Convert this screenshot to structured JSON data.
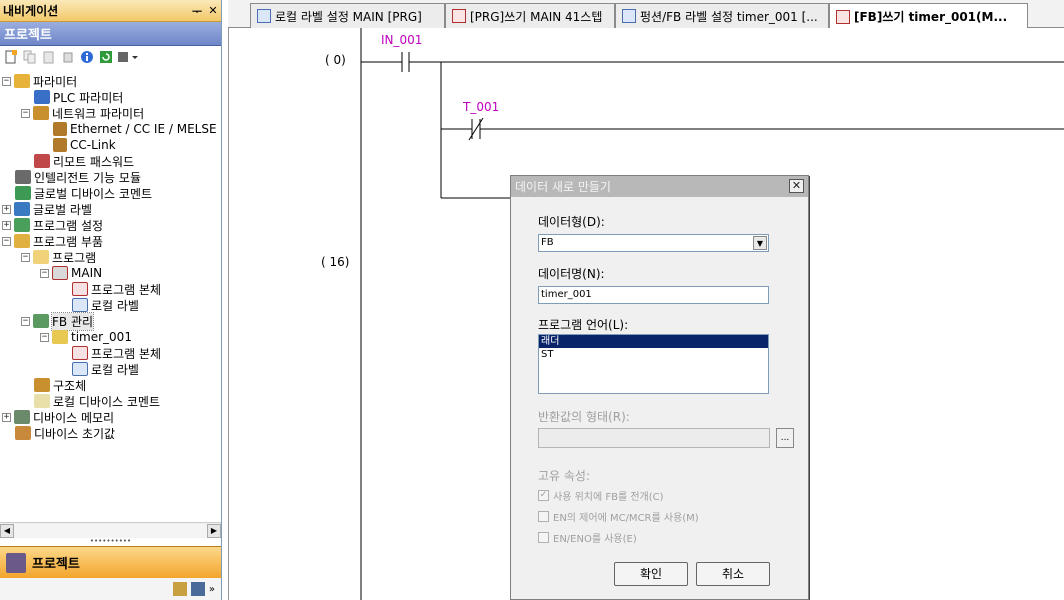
{
  "nav": {
    "title": "내비게이션",
    "pin": "ᅮ",
    "close": "✕",
    "project_header": "프로젝트",
    "tree": [
      {
        "label": "파라미터",
        "expander": "−"
      },
      {
        "label": "PLC 파라미터"
      },
      {
        "label": "네트워크 파라미터",
        "expander": "−"
      },
      {
        "label": "Ethernet / CC IE / MELSE"
      },
      {
        "label": "CC-Link"
      },
      {
        "label": "리모트 패스워드"
      },
      {
        "label": "인텔리전트 기능 모듈"
      },
      {
        "label": "글로벌 디바이스 코멘트"
      },
      {
        "label": "글로벌 라벨",
        "expander": "+"
      },
      {
        "label": "프로그램 설정",
        "expander": "+"
      },
      {
        "label": "프로그램 부품",
        "expander": "−"
      },
      {
        "label": "프로그램",
        "expander": "−"
      },
      {
        "label": "MAIN",
        "expander": "−"
      },
      {
        "label": "프로그램 본체"
      },
      {
        "label": "로컬 라벨"
      },
      {
        "label": "FB 관리",
        "expander": "−"
      },
      {
        "label": "timer_001",
        "expander": "−"
      },
      {
        "label": "프로그램 본체"
      },
      {
        "label": "로컬 라벨"
      },
      {
        "label": "구조체"
      },
      {
        "label": "로컬 디바이스 코멘트"
      },
      {
        "label": "디바이스 메모리",
        "expander": "+"
      },
      {
        "label": "디바이스 초기값"
      }
    ],
    "bottom_tab": "프로젝트"
  },
  "tabs": [
    {
      "label": "로컬 라벨 설정 MAIN [PRG]"
    },
    {
      "label": "[PRG]쓰기 MAIN 41스텝"
    },
    {
      "label": "펑션/FB 라벨 설정 timer_001 [..."
    },
    {
      "label": "[FB]쓰기 timer_001(M..."
    }
  ],
  "ladder": {
    "steps": [
      "(    0)",
      "(   16)"
    ],
    "contacts": [
      "IN_001",
      "T_001"
    ]
  },
  "dialog": {
    "title": "데이터 새로 만들기",
    "close": "✕",
    "data_type_label": "데이터형(D):",
    "data_type_value": "FB",
    "data_name_label": "데이터명(N):",
    "data_name_value": "timer_001",
    "language_label": "프로그램 언어(L):",
    "languages": [
      "래더",
      "ST"
    ],
    "selected_language": "래더",
    "return_type_label": "반환값의 형태(R):",
    "browse_label": "...",
    "properties_label": "고유 속성:",
    "options": [
      {
        "label": "사용 위치에 FB를 전개(C)",
        "checked": true
      },
      {
        "label": "EN의 제어에 MC/MCR를 사용(M)",
        "checked": false
      },
      {
        "label": "EN/ENO를 사용(E)",
        "checked": false
      }
    ],
    "ok_label": "확인",
    "cancel_label": "취소"
  },
  "colors": {
    "nav_title": "#f2c96a",
    "project_header": "#6f86c8",
    "project_tab": "#f2a52c",
    "label_magenta": "#c000c0",
    "list_selection": "#0a246a"
  }
}
